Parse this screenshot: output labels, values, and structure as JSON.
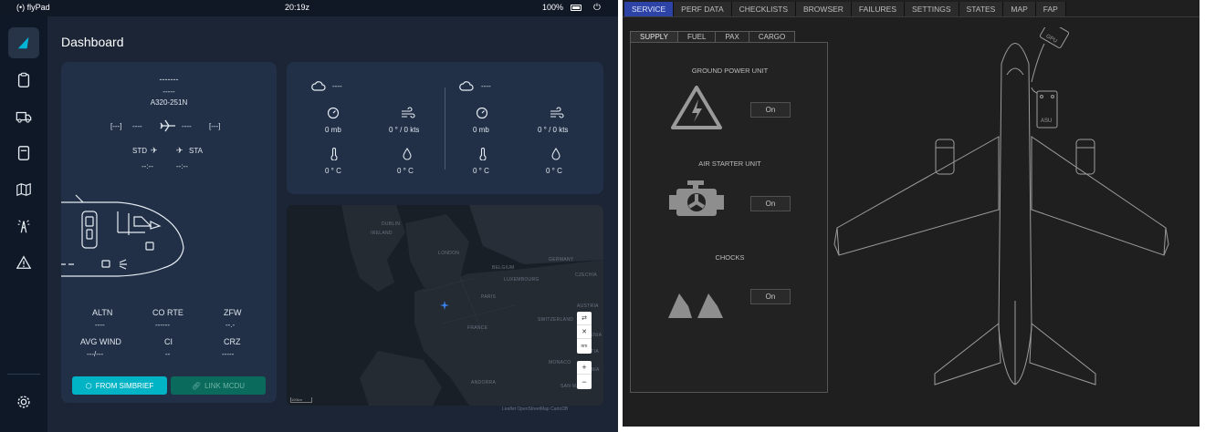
{
  "flypad": {
    "statusbar": {
      "app_name": "flyPad",
      "time": "20:19z",
      "battery": "100%"
    },
    "page_title": "Dashboard",
    "flight": {
      "flight_number": "-------",
      "registration": "-----",
      "aircraft": "A320-251N",
      "origin": "[---]",
      "route_left": "----",
      "route_right": "----",
      "destination": "[---]",
      "std_label": "STD",
      "sta_label": "STA",
      "std_value": "--:--",
      "sta_value": "--:--",
      "altn_label": "ALTN",
      "altn_value": "----",
      "corte_label": "CO RTE",
      "corte_value": "------",
      "zfw_label": "ZFW",
      "zfw_value": "--.-",
      "avgwind_label": "AVG WIND",
      "avgwind_value": "---/---",
      "ci_label": "CI",
      "ci_value": "--",
      "crz_label": "CRZ",
      "crz_value": "-----"
    },
    "buttons": {
      "simbrief": "FROM SIMBRIEF",
      "mcdu": "LINK MCDU"
    },
    "weather": [
      {
        "station": "----",
        "pressure": "0 mb",
        "wind": "0 ° / 0 kts",
        "temp": "0 ° C",
        "dewpoint": "0 ° C"
      },
      {
        "station": "----",
        "pressure": "0 mb",
        "wind": "0 ° / 0 kts",
        "temp": "0 ° C",
        "dewpoint": "0 ° C"
      }
    ],
    "map": {
      "labels": [
        "IRELAND",
        "LONDON",
        "GERMANY",
        "BELGIUM",
        "LUXEMBOURG",
        "FRANCE",
        "SWITZERLAND",
        "MONACO",
        "ANDORRA",
        "SAN MARINO",
        "DUBLIN",
        "PARIS",
        "CZECHIA",
        "AUSTRIA",
        "SLOVENIA",
        "BOSNIA",
        "CROATIA"
      ],
      "attribution": "Leaflet OpenStreetMap CartoDB",
      "scale": "100km"
    }
  },
  "efb": {
    "tabs": [
      "SERVICE",
      "PERF DATA",
      "CHECKLISTS",
      "BROWSER",
      "FAILURES",
      "SETTINGS",
      "STATES",
      "MAP",
      "FAP"
    ],
    "active_tab": "SERVICE",
    "subtabs": [
      "SUPPLY",
      "FUEL",
      "PAX",
      "CARGO"
    ],
    "active_subtab": "SUPPLY",
    "sections": [
      {
        "title": "GROUND POWER UNIT",
        "button": "On"
      },
      {
        "title": "AIR STARTER UNIT",
        "button": "On"
      },
      {
        "title": "CHOCKS",
        "button": "On"
      }
    ],
    "aircraft_labels": {
      "gpu": "GPU",
      "asu": "ASU"
    }
  }
}
